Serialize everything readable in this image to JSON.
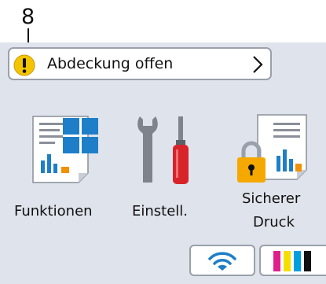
{
  "callout": {
    "number": "8"
  },
  "alert": {
    "text": "Abdeckung offen",
    "icon": "warning-icon",
    "chevron": "chevron-right-icon"
  },
  "functions": [
    {
      "label": "Funktionen",
      "icon": "functions-icon"
    },
    {
      "label": "Einstell.",
      "icon": "settings-icon"
    },
    {
      "label_line1": "Sicherer",
      "label_line2": "Druck",
      "icon": "secure-print-icon"
    }
  ],
  "status_buttons": [
    {
      "icon": "wifi-icon"
    },
    {
      "icon": "ink-icon",
      "colors": [
        "#e0208a",
        "#f4e000",
        "#00a0e0",
        "#111111"
      ]
    }
  ],
  "colors": {
    "screen_bg": "#dfe3ec",
    "warning": "#f5c400",
    "accent_blue": "#1e7fc8",
    "accent_orange": "#f29100",
    "screwdriver_red": "#d8232a"
  }
}
